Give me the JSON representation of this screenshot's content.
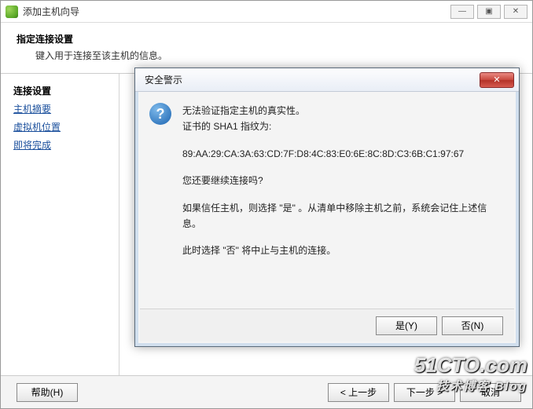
{
  "window": {
    "title": "添加主机向导",
    "controls": {
      "min": "—",
      "max": "▣",
      "close": "✕"
    }
  },
  "header": {
    "title": "指定连接设置",
    "subtitle": "键入用于连接至该主机的信息。"
  },
  "sidebar": {
    "items": [
      {
        "label": "连接设置",
        "state": "current"
      },
      {
        "label": "主机摘要",
        "state": "link"
      },
      {
        "label": "虚拟机位置",
        "state": "link"
      },
      {
        "label": "即将完成",
        "state": "link"
      }
    ]
  },
  "buttons": {
    "help": "帮助(H)",
    "back": "< 上一步",
    "next": "下一步 >",
    "cancel": "取消"
  },
  "dialog": {
    "title": "安全警示",
    "close_glyph": "✕",
    "icon_glyph": "?",
    "line1": "无法验证指定主机的真实性。",
    "line2": "证书的 SHA1 指纹为:",
    "fingerprint": "89:AA:29:CA:3A:63:CD:7F:D8:4C:83:E0:6E:8C:8D:C3:6B:C1:97:67",
    "line3": "您还要继续连接吗?",
    "line4": "如果信任主机，则选择 \"是\" 。从清单中移除主机之前，系统会记住上述信息。",
    "line5": "此时选择 \"否\" 将中止与主机的连接。",
    "yes": "是(Y)",
    "no": "否(N)"
  },
  "watermark": {
    "main": "51CTO.com",
    "sub": "技术博客 Blog"
  }
}
